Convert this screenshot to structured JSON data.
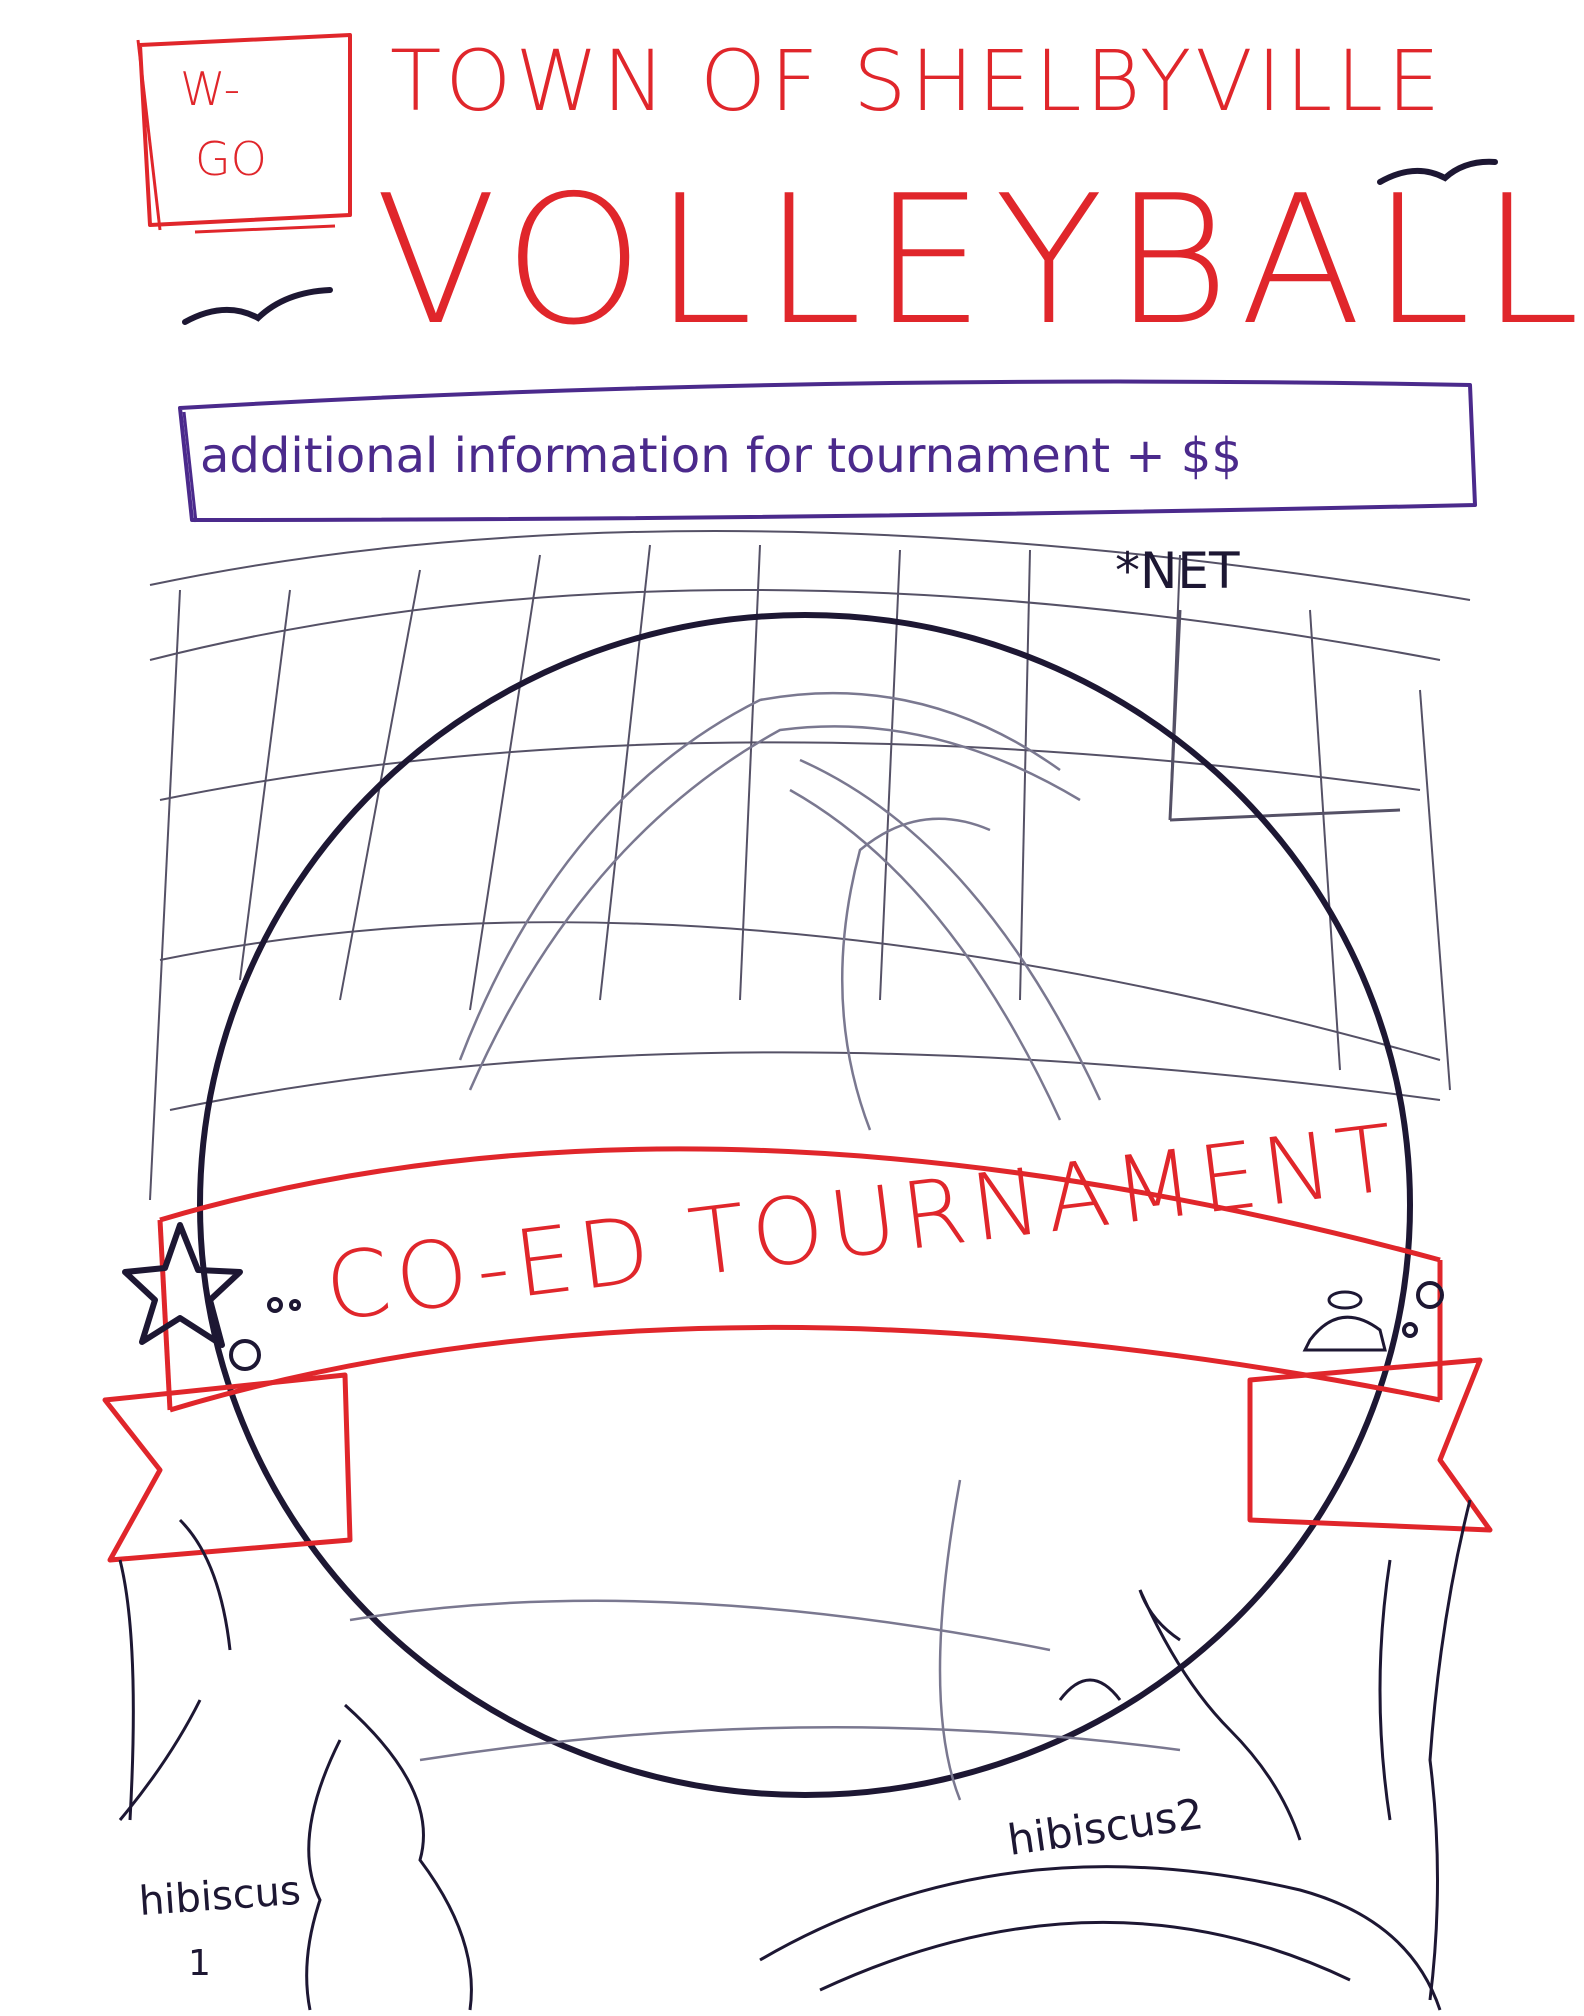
{
  "logo": {
    "line1": "W-",
    "line2": "GO"
  },
  "header": {
    "town": "TOWN OF SHELBYVILLE",
    "sport": "VOLLEYBALL"
  },
  "info_banner": {
    "text": "additional information for tournament + $$"
  },
  "annotations": {
    "net": "*NET",
    "hibiscus1": "hibiscus",
    "hibiscus1_num": "1",
    "hibiscus2": "hibiscus2"
  },
  "ribbon": {
    "text": "CO-ED TOURNAMENT"
  },
  "colors": {
    "red": "#e0262b",
    "purple": "#4b2a8c",
    "ink": "#1d1733",
    "sketch": "#7a7890"
  }
}
